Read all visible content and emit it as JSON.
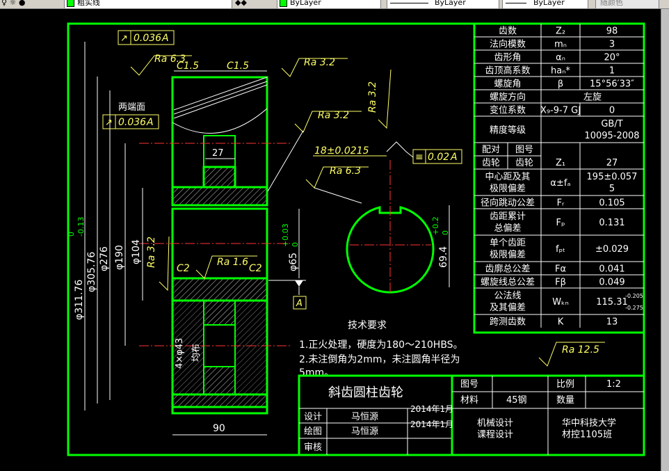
{
  "toolbar": {
    "layer_name": "粗实线",
    "color_value": "ByLayer",
    "linetype_value": "ByLayer",
    "lineweight_value": "ByLayer",
    "plotstyle_value": "随颜色"
  },
  "annotations": {
    "runout_top": "0.036",
    "runout_top_datum": "A",
    "two_end_faces": "两端面",
    "runout_ends": "0.036",
    "runout_ends_datum": "A",
    "ra_63_left": "Ra 6.3",
    "ra_32_top": "Ra 3.2",
    "chamfer_c15_left": "C1.5",
    "chamfer_c15_right": "C1.5",
    "ra_32_mid": "Ra 3.2",
    "ra_32_vertical": "Ra 3.2",
    "keyway_width": "18±0.0215",
    "symmetry_tol": "0.02",
    "symmetry_datum": "A",
    "ra_63_key": "Ra 6.3",
    "dim_27": "27",
    "dim_phi311": "φ311.76",
    "dim_phi311_tol": "0\n-0.13",
    "dim_phi305": "φ305.76",
    "dim_phi276": "φ276",
    "dim_phi190": "φ190",
    "dim_phi104": "φ104",
    "ra_32_left_v": "Ra 3.2",
    "dim_phi65": "φ65",
    "dim_phi65_tol": "+0.03\n0",
    "datum_a": "A",
    "chamfer_c2_left": "C2",
    "chamfer_c2_right": "C2",
    "ra_16": "Ra 1.6",
    "holes": "4×φ43",
    "holes_note": "均布",
    "dim_694": "69.4",
    "dim_694_tol": "+0.2\n0",
    "dim_90": "90",
    "ra_125": "Ra 12.5"
  },
  "spec_table": {
    "rows": [
      {
        "label": "齿数",
        "sym": "Z₂",
        "val": "98"
      },
      {
        "label": "法向模数",
        "sym": "mₙ",
        "val": "3"
      },
      {
        "label": "齿形角",
        "sym": "αₙ",
        "val": "20°"
      },
      {
        "label": "齿顶高系数",
        "sym": "haₙ*",
        "val": "1"
      },
      {
        "label": "螺旋角",
        "sym": "β",
        "val": "15°56′33″"
      },
      {
        "label": "螺旋方向",
        "sym": "",
        "val": "左旋"
      },
      {
        "label": "变位系数",
        "sym": "X₉-9-7 GJ",
        "val": "0"
      },
      {
        "label": "精度等级",
        "sym": "",
        "val": "GB/T\n10095-2008"
      },
      {
        "label1": "配对",
        "label2": "图号",
        "label3": "齿轮",
        "label4": "齿轮",
        "sym": "Z₁",
        "val": "27"
      },
      {
        "label": "中心距及其\n极限偏差",
        "sym": "α±fₐ",
        "val": "195±0.057\n5"
      },
      {
        "label": "径向跳动公差",
        "sym": "Fᵣ",
        "val": "0.105"
      },
      {
        "label": "齿距累计\n总偏差",
        "sym": "Fₚ",
        "val": "0.131"
      },
      {
        "label": "单个齿距\n极限偏差",
        "sym": "fₚₜ",
        "val": "±0.029"
      },
      {
        "label": "齿廓总公差",
        "sym": "Fα",
        "val": "0.041"
      },
      {
        "label": "螺旋线总公差",
        "sym": "Fβ",
        "val": "0.049"
      },
      {
        "label": "公法线\n及其偏差",
        "sym": "Wₖₙ",
        "val": "115.31",
        "val_tol": "-0.205\n-0.275"
      },
      {
        "label": "跨测齿数",
        "sym": "K",
        "val": "13"
      }
    ]
  },
  "tech_req": {
    "title": "技术要求",
    "line1": "1.正火处理，硬度为180～210HBS。",
    "line2": "2.未注倒角为2mm，未注圆角半径为",
    "line3": "5mm。"
  },
  "title_block": {
    "part_name": "斜齿圆柱齿轮",
    "drawing_no_label": "图号",
    "scale_label": "比例",
    "scale_value": "1:2",
    "material_label": "材料",
    "material_value": "45钢",
    "qty_label": "数量",
    "design_label": "设计",
    "designer": "马恒源",
    "design_date": "2014年1月",
    "draw_label": "绘图",
    "drafter": "马恒源",
    "draw_date": "2014年1月",
    "review_label": "审核",
    "course": "机械设计\n课程设计",
    "school": "华中科技大学\n材控1105班"
  }
}
